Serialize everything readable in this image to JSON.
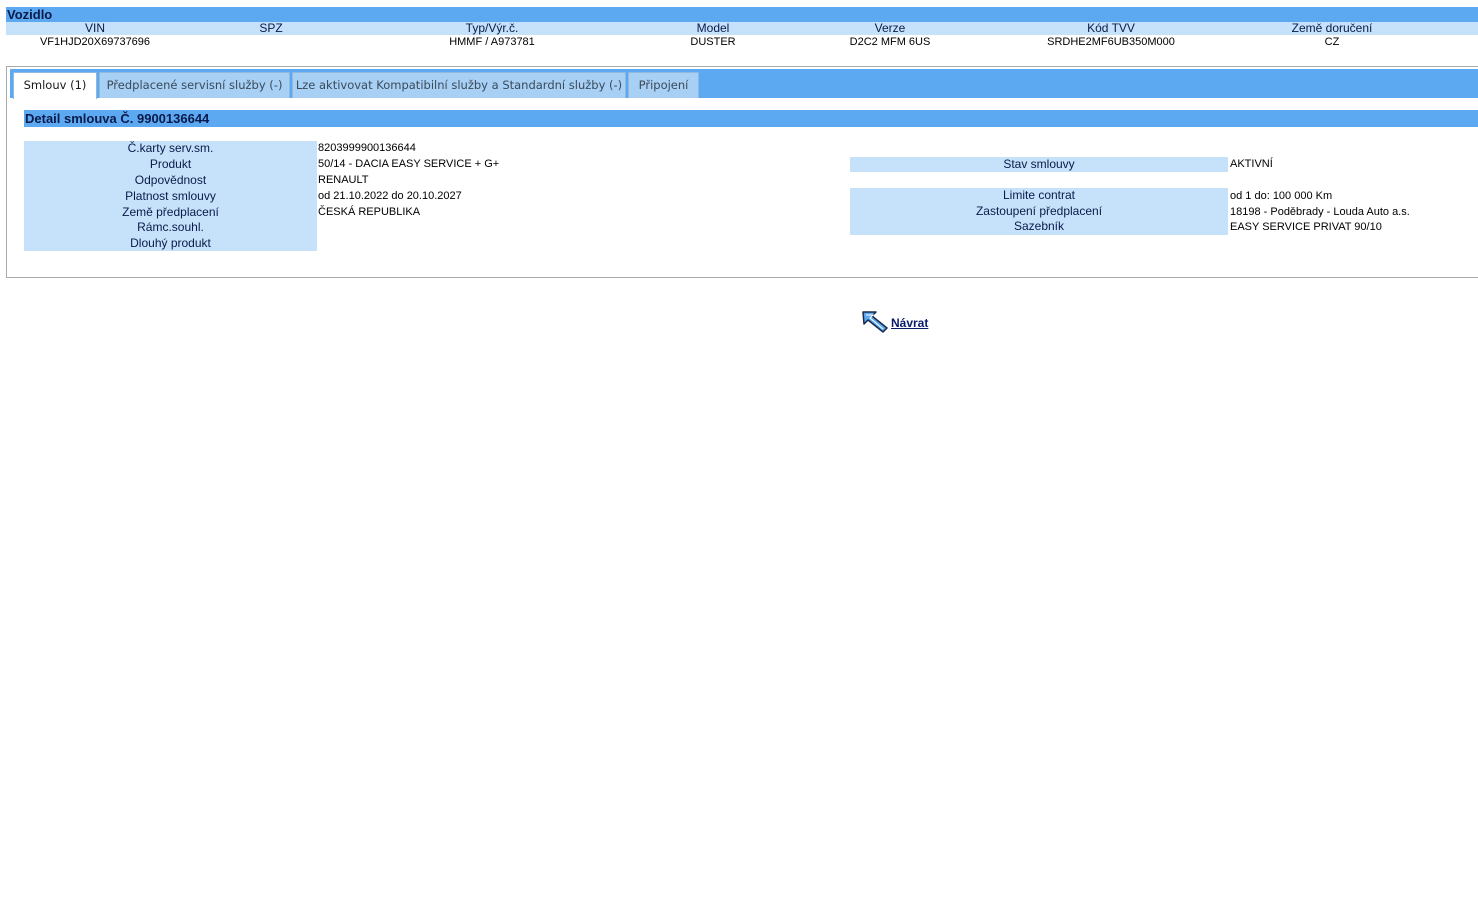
{
  "vehicle": {
    "title": "Vozidlo",
    "headers": [
      "VIN",
      "SPZ",
      "Typ/Výr.č.",
      "Model",
      "Verze",
      "Kód TVV",
      "Země doručení"
    ],
    "values": [
      "VF1HJD20X69737696",
      "",
      "HMMF / A973781",
      "DUSTER",
      "D2C2 MFM 6US",
      "SRDHE2MF6UB350M000",
      "CZ"
    ]
  },
  "tabs": [
    {
      "label": "Smlouv (1)",
      "active": true
    },
    {
      "label": "Předplacené servisní služby (-)",
      "active": false
    },
    {
      "label": "Lze aktivovat Kompatibilní služby a Standardní služby (-)",
      "active": false
    },
    {
      "label": "Připojení",
      "active": false
    }
  ],
  "detail": {
    "title": "Detail smlouva Č. 9900136644",
    "left": [
      {
        "label": "Č.karty serv.sm.",
        "value": "8203999900136644"
      },
      {
        "label": "Produkt",
        "value": "50/14 - DACIA EASY SERVICE + G+"
      },
      {
        "label": "Odpovědnost",
        "value": "RENAULT"
      },
      {
        "label": "Platnost smlouvy",
        "value": "od 21.10.2022 do 20.10.2027"
      },
      {
        "label": "Země předplacení",
        "value": "ČESKÁ REPUBLIKA"
      },
      {
        "label": "Rámc.souhl.",
        "value": ""
      },
      {
        "label": "Dlouhý produkt",
        "value": ""
      }
    ],
    "right": [
      {
        "label": "Stav smlouvy",
        "value": "AKTIVNÍ"
      },
      {
        "label": "Limite contrat",
        "value": "od 1 do: 100 000 Km"
      },
      {
        "label": "Zastoupení předplacení",
        "value": "18198 - Poděbrady - Louda Auto a.s."
      },
      {
        "label": "Sazebník",
        "value": "EASY SERVICE PRIVAT 90/10"
      }
    ]
  },
  "back": {
    "label": "Návrat",
    "icon": "back-arrow-icon"
  },
  "colors": {
    "header_blue": "#5ca9f2",
    "label_blue": "#c6e2fb",
    "tab_blue": "#a8d0f5"
  }
}
